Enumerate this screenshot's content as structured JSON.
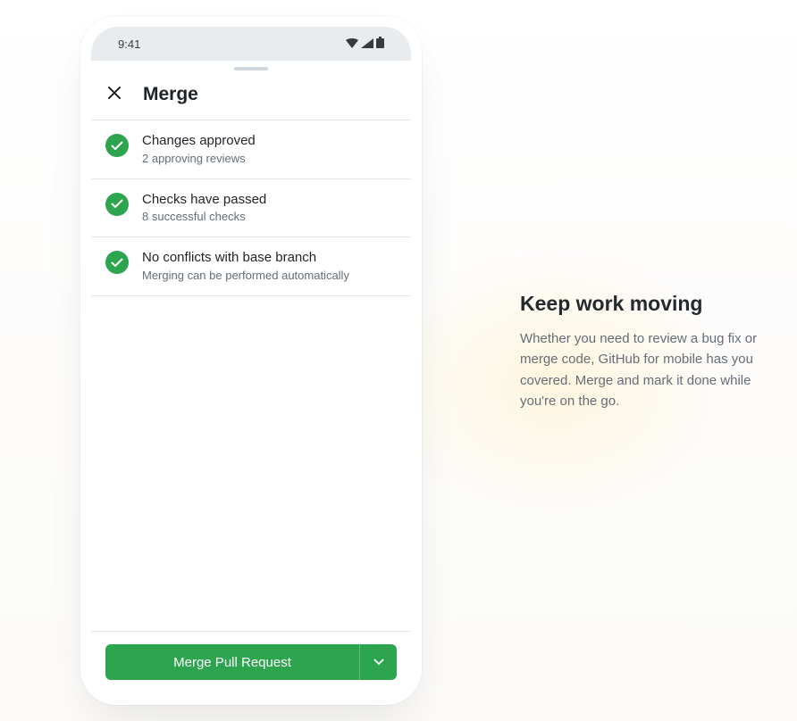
{
  "statusBar": {
    "time": "9:41"
  },
  "header": {
    "title": "Merge"
  },
  "statusItems": [
    {
      "title": "Changes approved",
      "subtitle": "2 approving reviews"
    },
    {
      "title": "Checks have passed",
      "subtitle": "8 successful checks"
    },
    {
      "title": "No conflicts with base branch",
      "subtitle": "Merging can be performed automatically"
    }
  ],
  "mergeButton": {
    "label": "Merge Pull Request"
  },
  "sideContent": {
    "title": "Keep work moving",
    "description": "Whether you need to review a bug fix or merge code, GitHub for mobile has you covered. Merge and mark it done while you're on the go."
  }
}
